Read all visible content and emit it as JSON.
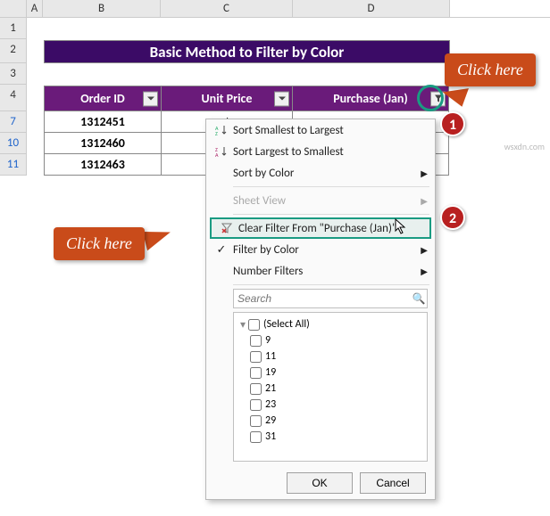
{
  "columns": [
    "A",
    "B",
    "C",
    "D"
  ],
  "rows": [
    "1",
    "2",
    "3",
    "4",
    "7",
    "10",
    "11"
  ],
  "filtered_rows": [
    "7",
    "10",
    "11"
  ],
  "title": "Basic Method to Filter by Color",
  "table": {
    "headers": [
      "Order ID",
      "Unit Price",
      "Purchase (Jan)"
    ],
    "rows": [
      {
        "id": "1312451",
        "price": "$",
        "purchase": ""
      },
      {
        "id": "1312460",
        "price": "$",
        "purchase": ""
      },
      {
        "id": "1312463",
        "price": "$",
        "purchase": ""
      }
    ]
  },
  "menu": {
    "sort_asc": "Sort Smallest to Largest",
    "sort_desc": "Sort Largest to Smallest",
    "sort_by_color": "Sort by Color",
    "sheet_view": "Sheet View",
    "clear_filter": "Clear Filter From \"Purchase (Jan)\"",
    "filter_by_color": "Filter by Color",
    "number_filters": "Number Filters",
    "search_placeholder": "Search",
    "tree": [
      "(Select All)",
      "9",
      "11",
      "19",
      "21",
      "23",
      "29",
      "31"
    ],
    "ok": "OK",
    "cancel": "Cancel"
  },
  "callouts": {
    "c1": "Click here",
    "c2": "Click here"
  },
  "badges": {
    "b1": "1",
    "b2": "2"
  },
  "watermark": "wsxdn.com"
}
